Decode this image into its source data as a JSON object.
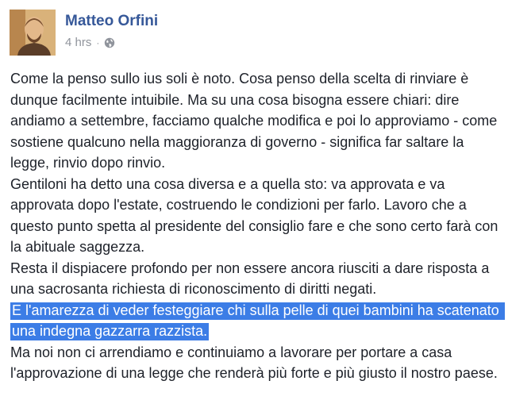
{
  "post": {
    "author": "Matteo Orfini",
    "timestamp": "4 hrs",
    "separator": "·",
    "privacy_icon": "globe-icon",
    "paragraphs": [
      "Come la penso sullo ius soli è noto. Cosa penso della scelta di rinviare è dunque facilmente intuibile. Ma su una cosa bisogna essere chiari: dire andiamo a settembre, facciamo qualche modifica e poi lo approviamo - come sostiene qualcuno nella maggioranza di governo - significa far saltare la legge, rinvio dopo rinvio.",
      "Gentiloni ha detto una cosa diversa e a quella sto: va approvata e va approvata dopo l'estate, costruendo le condizioni per farlo. Lavoro che a questo punto spetta al presidente del consiglio fare e che sono certo farà con la abituale saggezza.",
      "Resta il dispiacere profondo per non essere ancora riusciti a dare risposta a una sacrosanta richiesta di riconoscimento di diritti negati.",
      "E l'amarezza di veder festeggiare chi sulla pelle di quei bambini ha scatenato una indegna gazzarra razzista.",
      "Ma noi non ci arrendiamo e continuiamo a lavorare per portare a casa l'approvazione di una legge che renderà più forte e più giusto il nostro paese."
    ]
  },
  "colors": {
    "author_link": "#365899",
    "meta_text": "#90949c",
    "body_text": "#1d2129",
    "selection_highlight": "#3c7de6"
  }
}
